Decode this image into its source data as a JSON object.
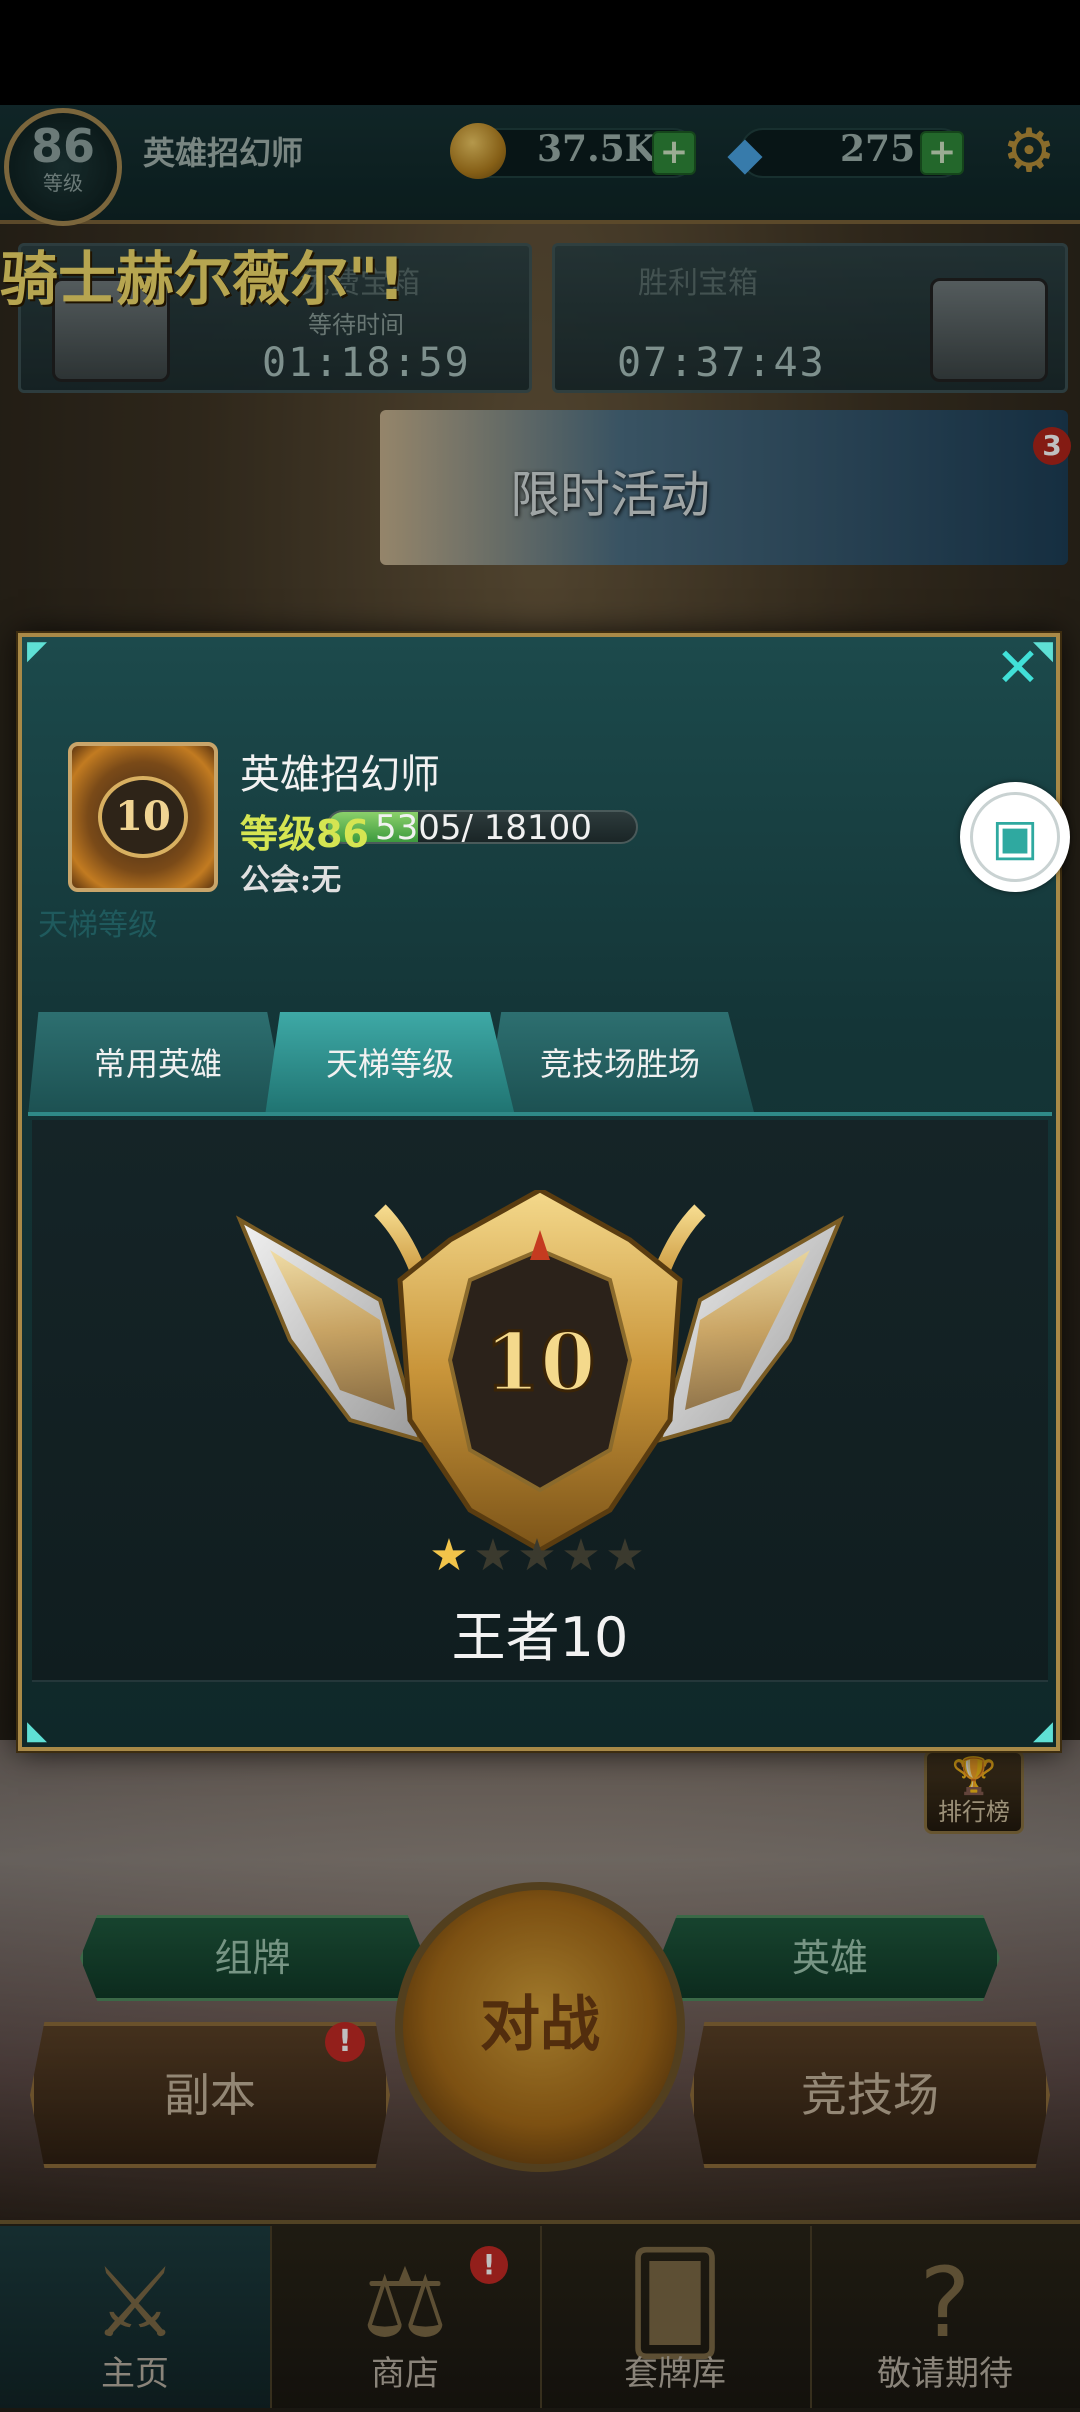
{
  "topbar": {
    "level": "86",
    "level_label": "等级",
    "player_name": "英雄招幻师",
    "coins": "37.5K",
    "gems": "275",
    "plus": "+"
  },
  "chests": {
    "left": {
      "title": "免费宝箱",
      "subtitle": "等待时间",
      "time": "01:18:59"
    },
    "right": {
      "title": "胜利宝箱",
      "time": "07:37:43"
    }
  },
  "marquee": "骑士赫尔薇尔\"!",
  "event": {
    "title": "限时活动",
    "badge": "3"
  },
  "profile": {
    "avatar_level": "10",
    "name": "英雄招幻师",
    "level_text": "等级86",
    "xp_text": "5305/ 18100",
    "xp_current": 5305,
    "xp_max": 18100,
    "guild": "公会:无",
    "ghost_text": "天梯等级",
    "tabs": [
      "常用英雄",
      "天梯等级",
      "竞技场胜场"
    ],
    "active_tab": 1,
    "rank_number": "10",
    "rank_stars_filled": 1,
    "rank_stars_total": 5,
    "rank_name": "王者10"
  },
  "side_button_icon": "cube-icon",
  "leaderboard_label": "排行榜",
  "actions": {
    "deck": "组牌",
    "heroes": "英雄",
    "dungeon": "副本",
    "arena": "竞技场",
    "battle": "对战",
    "alert": "!"
  },
  "nav": {
    "home": "主页",
    "shop": "商店",
    "decks": "套牌库",
    "soon": "敬请期待",
    "alert": "!"
  },
  "colors": {
    "accent_teal": "#41e0d8",
    "gold": "#a88947",
    "level_green": "#d5e552",
    "alert_red": "#c42a24"
  }
}
